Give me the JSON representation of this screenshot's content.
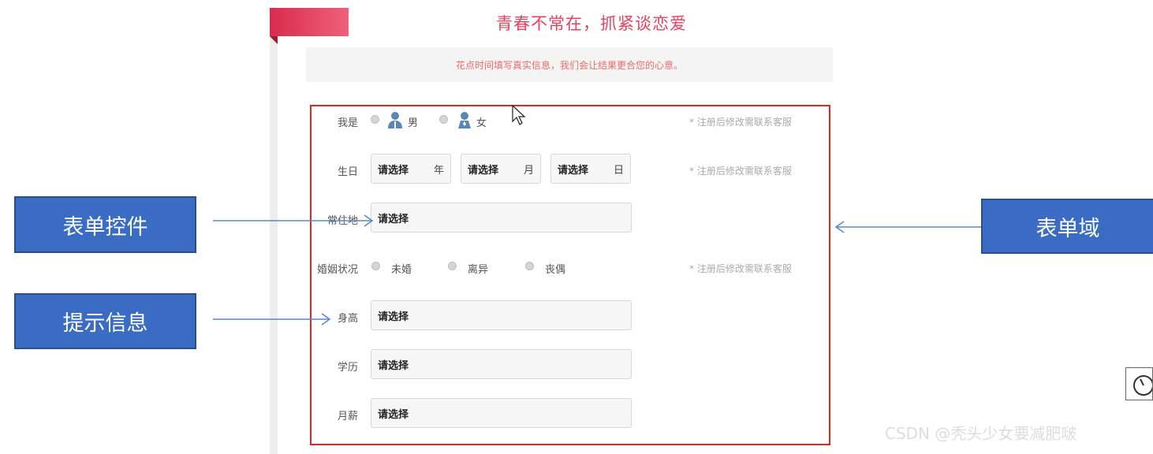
{
  "page": {
    "slogan": "青春不常在，抓紧谈恋爱",
    "tip": "花点时间填写真实信息，我们会让结果更合您的心意。"
  },
  "form": {
    "gender": {
      "label": "我是",
      "options": [
        "男",
        "女"
      ],
      "note": "* 注册后修改需联系客服"
    },
    "birthday": {
      "label": "生日",
      "selects": [
        {
          "value": "请选择",
          "unit": "年"
        },
        {
          "value": "请选择",
          "unit": "月"
        },
        {
          "value": "请选择",
          "unit": "日"
        }
      ],
      "note": "* 注册后修改需联系客服"
    },
    "residence": {
      "label": "常住地",
      "value": "请选择"
    },
    "marital": {
      "label": "婚姻状况",
      "options": [
        "未婚",
        "离异",
        "丧偶"
      ],
      "note": "* 注册后修改需联系客服"
    },
    "height": {
      "label": "身高",
      "value": "请选择"
    },
    "education": {
      "label": "学历",
      "value": "请选择"
    },
    "income": {
      "label": "月薪",
      "value": "请选择"
    }
  },
  "annotations": {
    "form_control": "表单控件",
    "hint_info": "提示信息",
    "form_domain": "表单域"
  },
  "colors": {
    "accent": "#e8405f",
    "form_border": "#e0281f",
    "callout_bg": "#3a6cc4",
    "arrow": "#5b86c9"
  },
  "watermark": "CSDN @秃头少女要减肥啵"
}
